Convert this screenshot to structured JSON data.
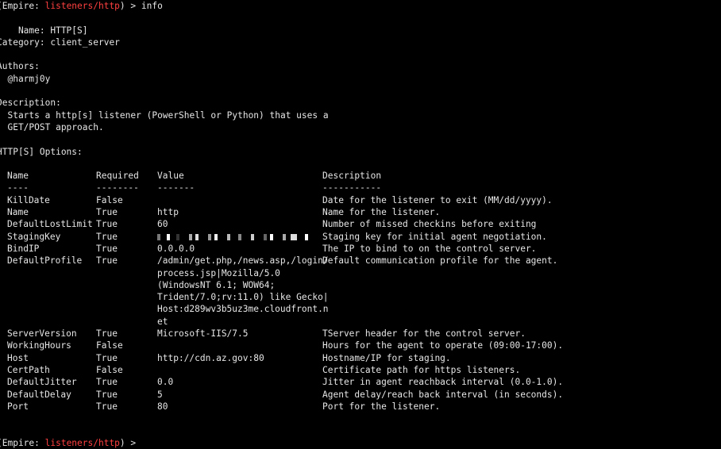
{
  "prompt": {
    "open": "(Empire: ",
    "module": "listeners/http",
    "close": ") > ",
    "command": "info"
  },
  "info": {
    "name_line": "    Name: HTTP[S]",
    "category_line": "Category: client_server",
    "authors_header": "Authors:",
    "author": "  @harmj0y",
    "description_header": "Description:",
    "description_lines": [
      "  Starts a http[s] listener (PowerShell or Python) that uses a",
      "  GET/POST approach."
    ]
  },
  "options_header": "HTTP[S] Options:",
  "table": {
    "headers": {
      "name": "Name",
      "required": "Required",
      "value": "Value",
      "description": "Description"
    },
    "dashes": {
      "name": "----",
      "required": "--------",
      "value": "-------",
      "description": "-----------"
    },
    "rows": [
      {
        "name": "KillDate",
        "required": "False",
        "value": "",
        "description": "Date for the listener to exit (MM/dd/yyyy)."
      },
      {
        "name": "Name",
        "required": "True",
        "value": "http",
        "description": "Name for the listener."
      },
      {
        "name": "DefaultLostLimit",
        "required": "True",
        "value": "60",
        "description": "Number of missed checkins before exiting"
      },
      {
        "name": "StagingKey",
        "required": "True",
        "value": "",
        "description": "Staging key for initial agent negotiation."
      },
      {
        "name": "BindIP",
        "required": "True",
        "value": "0.0.0.0",
        "description": "The IP to bind to on the control server."
      },
      {
        "name": "DefaultProfile",
        "required": "True",
        "value": "/admin/get.php,/news.asp,/login/",
        "description": "Default communication profile for the agent."
      }
    ],
    "profile_continuation": [
      "process.jsp|Mozilla/5.0",
      "(WindowsNT 6.1; WOW64;",
      "Trident/7.0;rv:11.0) like Gecko|",
      "Host:d289wv3b5uz3me.cloudfront.n",
      "et"
    ],
    "rows2": [
      {
        "name": "ServerVersion",
        "required": "True",
        "value": "Microsoft-IIS/7.5",
        "description": "TServer header for the control server."
      },
      {
        "name": "WorkingHours",
        "required": "False",
        "value": "",
        "description": "Hours for the agent to operate (09:00-17:00)."
      },
      {
        "name": "Host",
        "required": "True",
        "value": "http://cdn.az.gov:80",
        "description": "Hostname/IP for staging."
      },
      {
        "name": "CertPath",
        "required": "False",
        "value": "",
        "description": "Certificate path for https listeners."
      },
      {
        "name": "DefaultJitter",
        "required": "True",
        "value": "0.0",
        "description": "Jitter in agent reachback interval (0.0-1.0)."
      },
      {
        "name": "DefaultDelay",
        "required": "True",
        "value": "5",
        "description": "Agent delay/reach back interval (in seconds)."
      },
      {
        "name": "Port",
        "required": "True",
        "value": "80",
        "description": "Port for the listener."
      }
    ]
  },
  "prompt2": {
    "open": "(Empire: ",
    "module": "listeners/http",
    "close": ") > "
  },
  "colors": {
    "background": "#000000",
    "text": "#e6e6e6",
    "module": "#ff4040"
  }
}
